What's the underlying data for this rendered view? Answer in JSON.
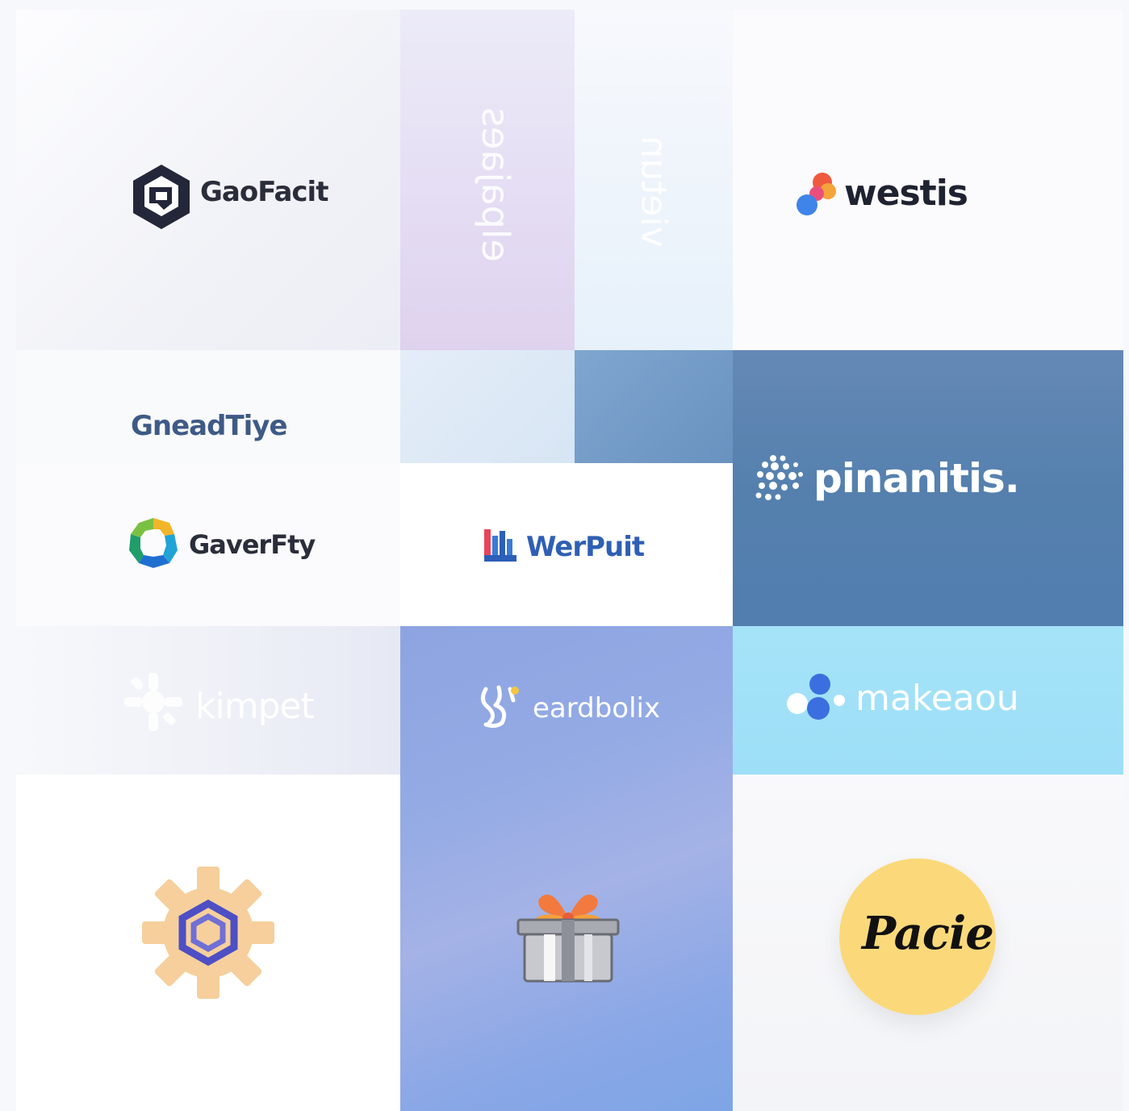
{
  "tiles": {
    "goofacit": {
      "name": "GaoFacit"
    },
    "vertical_1": {
      "text": "elpajaes"
    },
    "vertical_2": {
      "text": "vietun"
    },
    "westis": {
      "name": "westis"
    },
    "gneadtiye": {
      "name": "GneadTiye"
    },
    "pinanitis": {
      "name": "pinanitis."
    },
    "gaverfty": {
      "name": "GaverFty"
    },
    "werpuit": {
      "name": "WerPuit"
    },
    "kimpet": {
      "name": "kimpet"
    },
    "eardbolix": {
      "name": "eardbolix"
    },
    "makeaou": {
      "name": "makeaou"
    },
    "pacie": {
      "name": "Pacie"
    }
  },
  "icons": {
    "goofacit": "hexagon-logo-icon",
    "westis": "colored-dots-logo-icon",
    "pinanitis": "dot-cluster-logo-icon",
    "gaverfty": "multicolor-ring-logo-icon",
    "werpuit": "bars-logo-icon",
    "kimpet": "star-burst-logo-icon",
    "eardbolix": "figure-logo-icon",
    "makeaou": "bubbles-logo-icon",
    "gear": "gear-hexagon-icon",
    "gift": "gift-box-icon",
    "pacie": "yellow-circle-badge"
  },
  "colors": {
    "dark_text": "#2a2d3a",
    "blue_panel": "#557fae",
    "light_blue_panel": "#9ee0f7",
    "periwinkle_panel": "#8fa6e6",
    "pacie_badge": "#fbd97a",
    "gear": "#f6cf9c"
  }
}
